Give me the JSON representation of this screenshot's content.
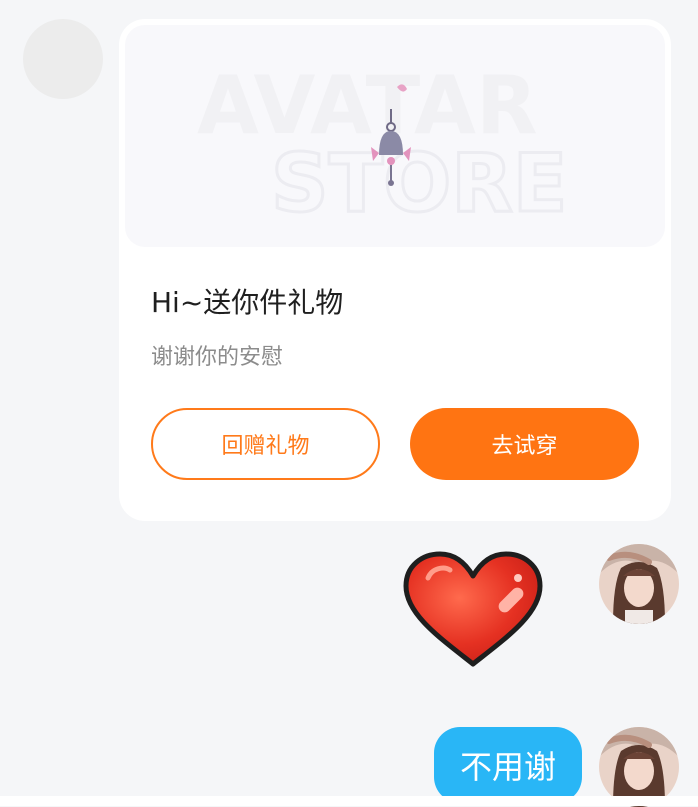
{
  "gift_card": {
    "banner_text_line1": "AVATAR",
    "banner_text_line2": "STORE",
    "title": "Hi~送你件礼物",
    "subtitle": "谢谢你的安慰",
    "return_gift_label": "回赠礼物",
    "try_on_label": "去试穿"
  },
  "messages": {
    "reply_text": "不用谢"
  },
  "colors": {
    "accent_orange": "#ff7412",
    "bubble_blue": "#29b6f6",
    "heart_red": "#e53935"
  }
}
